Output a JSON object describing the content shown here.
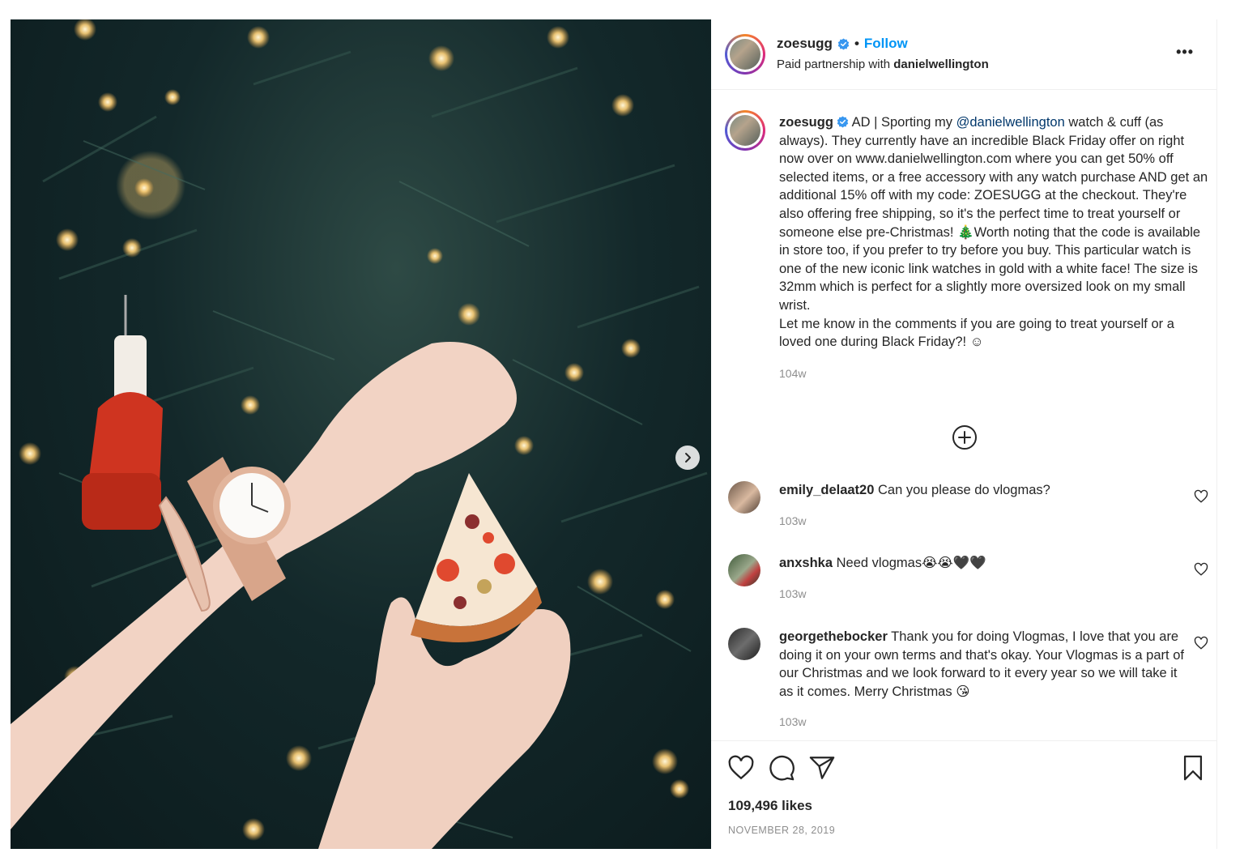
{
  "post": {
    "username": "zoesugg",
    "follow_label": "Follow",
    "separator": "•",
    "partnership_prefix": "Paid partnership with",
    "partner": "danielwellington",
    "more_icon": "more-horizontal-icon",
    "more_label": "•••"
  },
  "caption": {
    "username": "zoesugg",
    "text_before_mention": " AD | Sporting my ",
    "mention": "@danielwellington",
    "text_after_mention": " watch & cuff (as always). They currently have an incredible Black Friday offer on right now over on www.danielwellington.com where you can get 50% off selected items, or a free accessory with any watch purchase AND get an additional 15% off with my code: ZOESUGG at the checkout. They're also offering free shipping, so it's the perfect time to treat yourself or someone else pre-Christmas! 🎄Worth noting that the code is available in store too, if you prefer to try before you buy. This particular watch is one of the new iconic link watches in gold with a white face! The size is 32mm which is perfect for a slightly more oversized look on my small wrist.",
    "text_line2": "Let me know in the comments if you are going to treat yourself or a loved one during Black Friday?! ☺",
    "age": "104w"
  },
  "comments": [
    {
      "username": "emily_delaat20",
      "text": " Can you please do vlogmas?",
      "age": "103w"
    },
    {
      "username": "anxshka",
      "text": " Need vlogmas😭😭🖤🖤",
      "age": "103w"
    },
    {
      "username": "georgethebocker",
      "text": " Thank you for doing Vlogmas, I love that you are doing it on your own terms and that's okay. Your Vlogmas is a part of our Christmas and we look forward to it every year so we will take it as it comes. Merry Christmas 😘",
      "age": "103w"
    }
  ],
  "footer": {
    "likes": "109,496 likes",
    "date": "NOVEMBER 28, 2019"
  },
  "colors": {
    "link": "#0095f6",
    "mention": "#00376b",
    "muted": "#8e8e8e"
  }
}
